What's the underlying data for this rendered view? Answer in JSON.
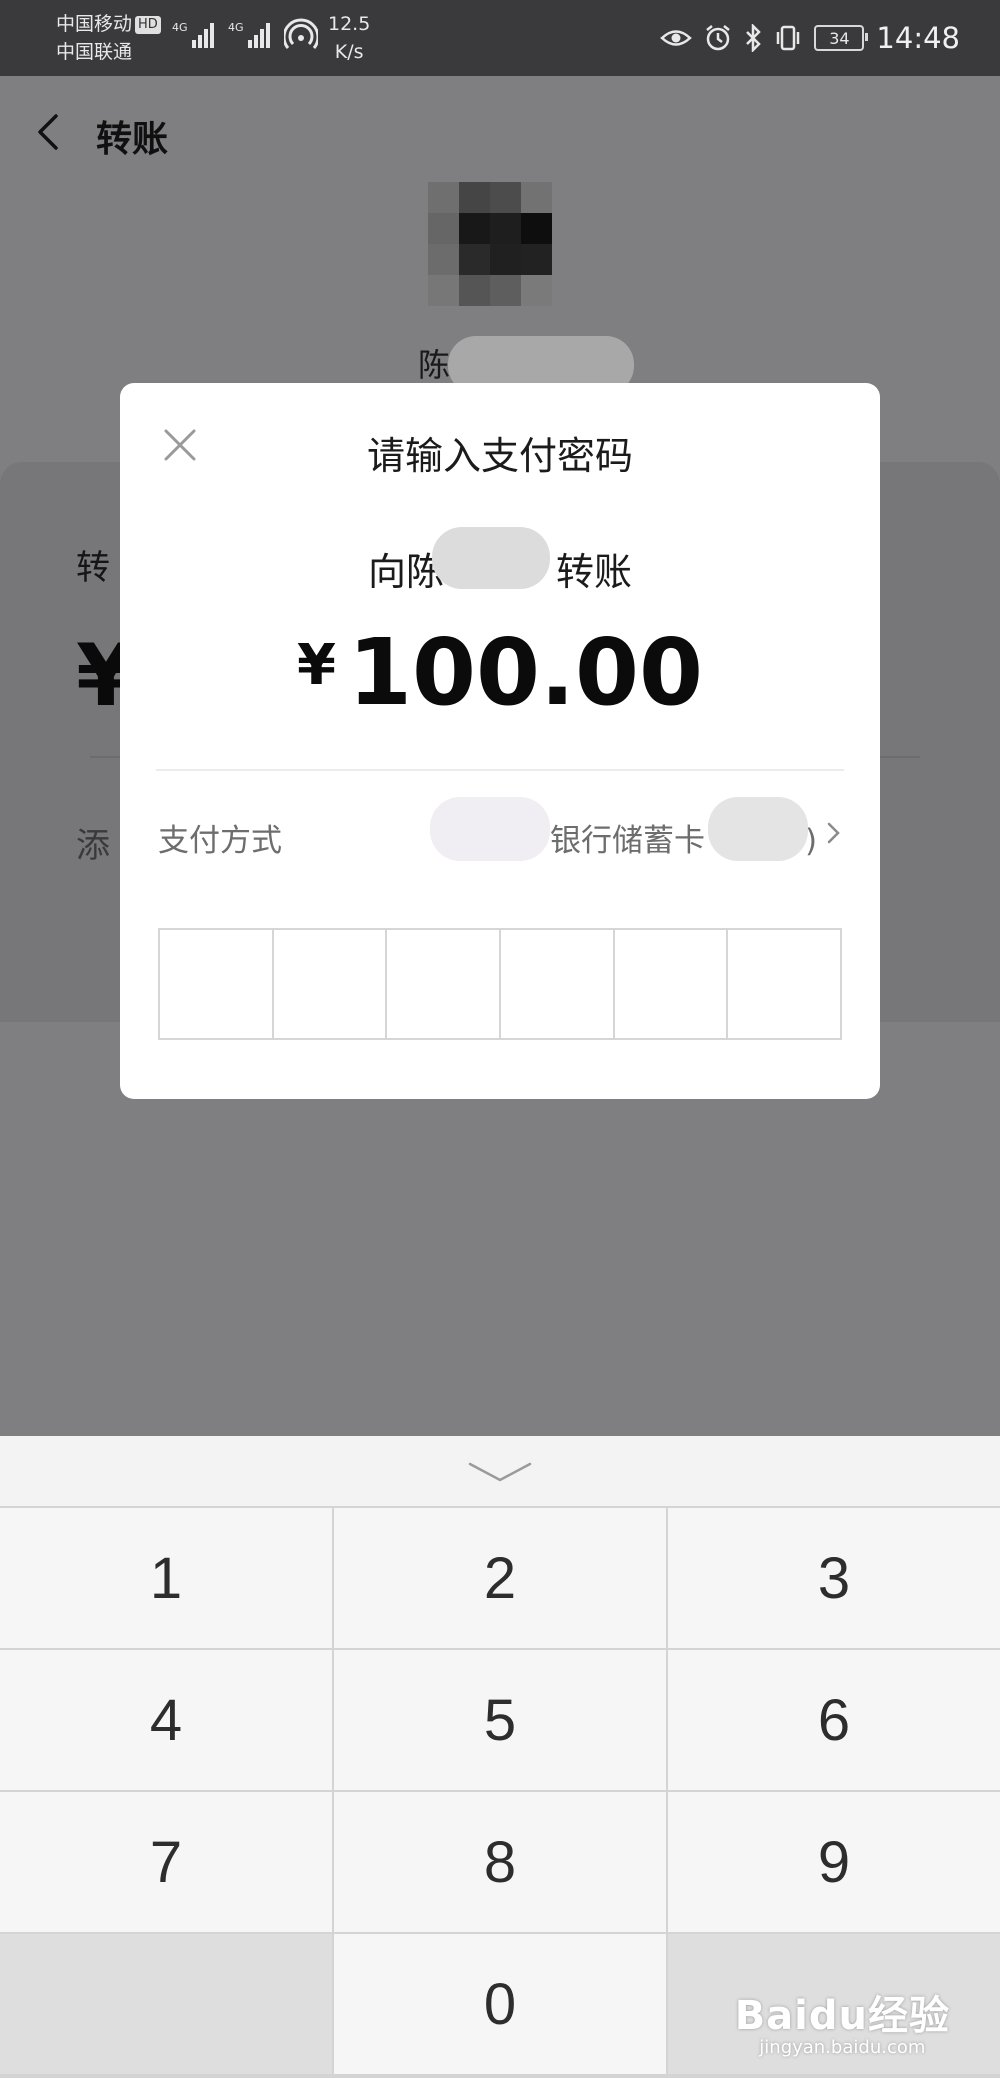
{
  "status_bar": {
    "carrier1": "中国移动",
    "hd_badge": "HD",
    "carrier2": "中国联通",
    "net_tag1": "4G",
    "net_tag2": "4G",
    "speed_value": "12.5",
    "speed_unit": "K/s",
    "battery": "34",
    "time": "14:48"
  },
  "header": {
    "title": "转账",
    "back_icon": "chevron-left-icon"
  },
  "background_page": {
    "recipient_name_prefix": "陈",
    "label_prefix": "转",
    "yen_symbol": "¥",
    "note_prefix": "添"
  },
  "dialog": {
    "title": "请输入支付密码",
    "transfer_to_prefix": "向陈",
    "transfer_to_suffix": "转账",
    "amount_currency": "¥",
    "amount_value": "100.00",
    "payment_method_label": "支付方式",
    "payment_method_value": "银行储蓄卡",
    "payment_method_tail": ")",
    "password_length": 6
  },
  "keypad": {
    "keys": [
      "1",
      "2",
      "3",
      "4",
      "5",
      "6",
      "7",
      "8",
      "9",
      "",
      "0",
      ""
    ]
  },
  "watermark": {
    "brand": "Baidu经验",
    "url": "jingyan.baidu.com"
  }
}
